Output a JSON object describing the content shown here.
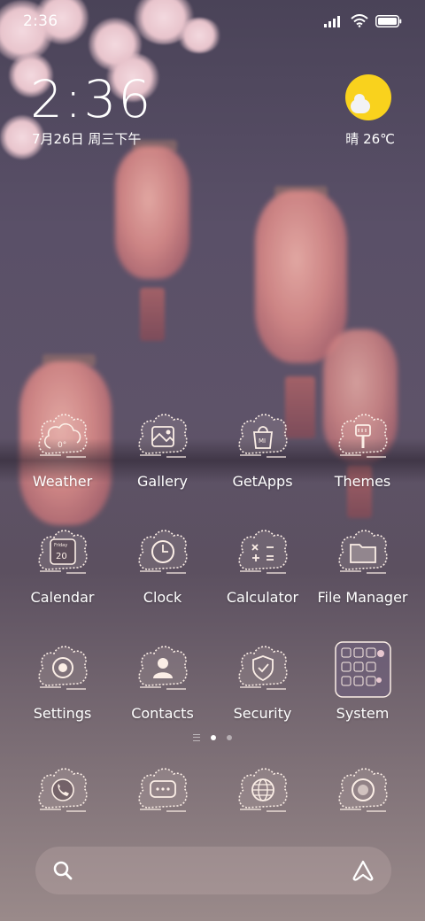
{
  "status_bar": {
    "time": "2:36"
  },
  "lock_clock": {
    "time": "2:36",
    "date": "7月26日 周三下午"
  },
  "weather_widget": {
    "text": "晴 26℃",
    "sun_color": "#f9d21d"
  },
  "apps": [
    {
      "label": "Weather",
      "icon": "weather-icon",
      "glyph": "0°"
    },
    {
      "label": "Gallery",
      "icon": "gallery-icon"
    },
    {
      "label": "GetApps",
      "icon": "getapps-icon",
      "glyph": "MI"
    },
    {
      "label": "Themes",
      "icon": "themes-icon"
    },
    {
      "label": "Calendar",
      "icon": "calendar-icon",
      "glyph_top": "Friday",
      "glyph": "20"
    },
    {
      "label": "Clock",
      "icon": "clock-icon"
    },
    {
      "label": "Calculator",
      "icon": "calculator-icon"
    },
    {
      "label": "File Manager",
      "icon": "file-manager-icon"
    },
    {
      "label": "Settings",
      "icon": "settings-icon"
    },
    {
      "label": "Contacts",
      "icon": "contacts-icon"
    },
    {
      "label": "Security",
      "icon": "security-icon"
    },
    {
      "label": "System",
      "icon": "system-folder-icon"
    }
  ],
  "page_indicator": {
    "pages": 2,
    "current": 1
  },
  "dock": [
    {
      "icon": "phone-icon"
    },
    {
      "icon": "messages-icon"
    },
    {
      "icon": "browser-icon"
    },
    {
      "icon": "camera-icon"
    }
  ],
  "search_bar": {
    "left_icon": "search-icon",
    "right_icon": "assistant-icon"
  },
  "colors": {
    "icon_outline": "#fbeee6",
    "accent": "#f9d21d"
  }
}
